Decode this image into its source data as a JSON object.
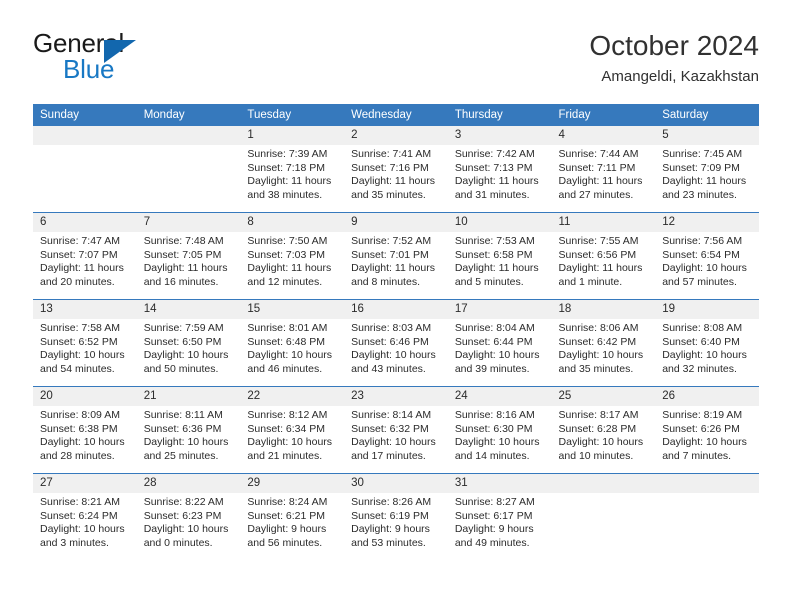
{
  "brand": {
    "name_part1": "General",
    "name_part2": "Blue",
    "logo_icon": "triangle-logo-icon",
    "accent_color": "#1878c4"
  },
  "header": {
    "title": "October 2024",
    "subtitle": "Amangeldi, Kazakhstan"
  },
  "calendar": {
    "header_bg": "#3679bd",
    "daynum_bg": "#f0f0f0",
    "weekday_headers": [
      "Sunday",
      "Monday",
      "Tuesday",
      "Wednesday",
      "Thursday",
      "Friday",
      "Saturday"
    ],
    "labels": {
      "sunrise": "Sunrise:",
      "sunset": "Sunset:",
      "daylight": "Daylight:"
    },
    "weeks": [
      [
        {
          "day": "",
          "empty": true
        },
        {
          "day": "",
          "empty": true
        },
        {
          "day": "1",
          "sunrise": "Sunrise: 7:39 AM",
          "sunset": "Sunset: 7:18 PM",
          "daylight_line1": "Daylight: 11 hours",
          "daylight_line2": "and 38 minutes."
        },
        {
          "day": "2",
          "sunrise": "Sunrise: 7:41 AM",
          "sunset": "Sunset: 7:16 PM",
          "daylight_line1": "Daylight: 11 hours",
          "daylight_line2": "and 35 minutes."
        },
        {
          "day": "3",
          "sunrise": "Sunrise: 7:42 AM",
          "sunset": "Sunset: 7:13 PM",
          "daylight_line1": "Daylight: 11 hours",
          "daylight_line2": "and 31 minutes."
        },
        {
          "day": "4",
          "sunrise": "Sunrise: 7:44 AM",
          "sunset": "Sunset: 7:11 PM",
          "daylight_line1": "Daylight: 11 hours",
          "daylight_line2": "and 27 minutes."
        },
        {
          "day": "5",
          "sunrise": "Sunrise: 7:45 AM",
          "sunset": "Sunset: 7:09 PM",
          "daylight_line1": "Daylight: 11 hours",
          "daylight_line2": "and 23 minutes."
        }
      ],
      [
        {
          "day": "6",
          "sunrise": "Sunrise: 7:47 AM",
          "sunset": "Sunset: 7:07 PM",
          "daylight_line1": "Daylight: 11 hours",
          "daylight_line2": "and 20 minutes."
        },
        {
          "day": "7",
          "sunrise": "Sunrise: 7:48 AM",
          "sunset": "Sunset: 7:05 PM",
          "daylight_line1": "Daylight: 11 hours",
          "daylight_line2": "and 16 minutes."
        },
        {
          "day": "8",
          "sunrise": "Sunrise: 7:50 AM",
          "sunset": "Sunset: 7:03 PM",
          "daylight_line1": "Daylight: 11 hours",
          "daylight_line2": "and 12 minutes."
        },
        {
          "day": "9",
          "sunrise": "Sunrise: 7:52 AM",
          "sunset": "Sunset: 7:01 PM",
          "daylight_line1": "Daylight: 11 hours",
          "daylight_line2": "and 8 minutes."
        },
        {
          "day": "10",
          "sunrise": "Sunrise: 7:53 AM",
          "sunset": "Sunset: 6:58 PM",
          "daylight_line1": "Daylight: 11 hours",
          "daylight_line2": "and 5 minutes."
        },
        {
          "day": "11",
          "sunrise": "Sunrise: 7:55 AM",
          "sunset": "Sunset: 6:56 PM",
          "daylight_line1": "Daylight: 11 hours",
          "daylight_line2": "and 1 minute."
        },
        {
          "day": "12",
          "sunrise": "Sunrise: 7:56 AM",
          "sunset": "Sunset: 6:54 PM",
          "daylight_line1": "Daylight: 10 hours",
          "daylight_line2": "and 57 minutes."
        }
      ],
      [
        {
          "day": "13",
          "sunrise": "Sunrise: 7:58 AM",
          "sunset": "Sunset: 6:52 PM",
          "daylight_line1": "Daylight: 10 hours",
          "daylight_line2": "and 54 minutes."
        },
        {
          "day": "14",
          "sunrise": "Sunrise: 7:59 AM",
          "sunset": "Sunset: 6:50 PM",
          "daylight_line1": "Daylight: 10 hours",
          "daylight_line2": "and 50 minutes."
        },
        {
          "day": "15",
          "sunrise": "Sunrise: 8:01 AM",
          "sunset": "Sunset: 6:48 PM",
          "daylight_line1": "Daylight: 10 hours",
          "daylight_line2": "and 46 minutes."
        },
        {
          "day": "16",
          "sunrise": "Sunrise: 8:03 AM",
          "sunset": "Sunset: 6:46 PM",
          "daylight_line1": "Daylight: 10 hours",
          "daylight_line2": "and 43 minutes."
        },
        {
          "day": "17",
          "sunrise": "Sunrise: 8:04 AM",
          "sunset": "Sunset: 6:44 PM",
          "daylight_line1": "Daylight: 10 hours",
          "daylight_line2": "and 39 minutes."
        },
        {
          "day": "18",
          "sunrise": "Sunrise: 8:06 AM",
          "sunset": "Sunset: 6:42 PM",
          "daylight_line1": "Daylight: 10 hours",
          "daylight_line2": "and 35 minutes."
        },
        {
          "day": "19",
          "sunrise": "Sunrise: 8:08 AM",
          "sunset": "Sunset: 6:40 PM",
          "daylight_line1": "Daylight: 10 hours",
          "daylight_line2": "and 32 minutes."
        }
      ],
      [
        {
          "day": "20",
          "sunrise": "Sunrise: 8:09 AM",
          "sunset": "Sunset: 6:38 PM",
          "daylight_line1": "Daylight: 10 hours",
          "daylight_line2": "and 28 minutes."
        },
        {
          "day": "21",
          "sunrise": "Sunrise: 8:11 AM",
          "sunset": "Sunset: 6:36 PM",
          "daylight_line1": "Daylight: 10 hours",
          "daylight_line2": "and 25 minutes."
        },
        {
          "day": "22",
          "sunrise": "Sunrise: 8:12 AM",
          "sunset": "Sunset: 6:34 PM",
          "daylight_line1": "Daylight: 10 hours",
          "daylight_line2": "and 21 minutes."
        },
        {
          "day": "23",
          "sunrise": "Sunrise: 8:14 AM",
          "sunset": "Sunset: 6:32 PM",
          "daylight_line1": "Daylight: 10 hours",
          "daylight_line2": "and 17 minutes."
        },
        {
          "day": "24",
          "sunrise": "Sunrise: 8:16 AM",
          "sunset": "Sunset: 6:30 PM",
          "daylight_line1": "Daylight: 10 hours",
          "daylight_line2": "and 14 minutes."
        },
        {
          "day": "25",
          "sunrise": "Sunrise: 8:17 AM",
          "sunset": "Sunset: 6:28 PM",
          "daylight_line1": "Daylight: 10 hours",
          "daylight_line2": "and 10 minutes."
        },
        {
          "day": "26",
          "sunrise": "Sunrise: 8:19 AM",
          "sunset": "Sunset: 6:26 PM",
          "daylight_line1": "Daylight: 10 hours",
          "daylight_line2": "and 7 minutes."
        }
      ],
      [
        {
          "day": "27",
          "sunrise": "Sunrise: 8:21 AM",
          "sunset": "Sunset: 6:24 PM",
          "daylight_line1": "Daylight: 10 hours",
          "daylight_line2": "and 3 minutes."
        },
        {
          "day": "28",
          "sunrise": "Sunrise: 8:22 AM",
          "sunset": "Sunset: 6:23 PM",
          "daylight_line1": "Daylight: 10 hours",
          "daylight_line2": "and 0 minutes."
        },
        {
          "day": "29",
          "sunrise": "Sunrise: 8:24 AM",
          "sunset": "Sunset: 6:21 PM",
          "daylight_line1": "Daylight: 9 hours",
          "daylight_line2": "and 56 minutes."
        },
        {
          "day": "30",
          "sunrise": "Sunrise: 8:26 AM",
          "sunset": "Sunset: 6:19 PM",
          "daylight_line1": "Daylight: 9 hours",
          "daylight_line2": "and 53 minutes."
        },
        {
          "day": "31",
          "sunrise": "Sunrise: 8:27 AM",
          "sunset": "Sunset: 6:17 PM",
          "daylight_line1": "Daylight: 9 hours",
          "daylight_line2": "and 49 minutes."
        },
        {
          "day": "",
          "empty": true
        },
        {
          "day": "",
          "empty": true
        }
      ]
    ]
  }
}
